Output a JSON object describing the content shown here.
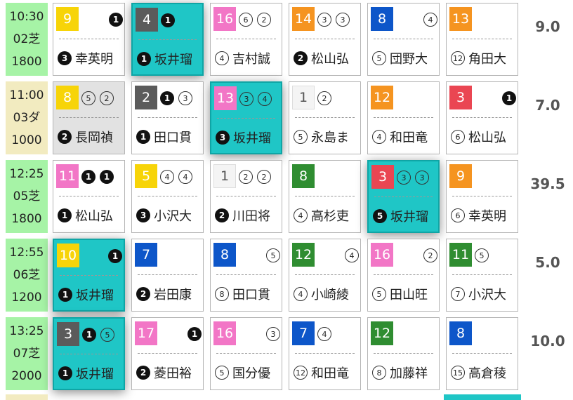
{
  "colors": {
    "yellow": "#f7d408",
    "dark_gray": "#5b5b5b",
    "pink": "#f276c6",
    "orange": "#f59420",
    "blue": "#0d56c9",
    "red": "#ea4652",
    "green": "#2f8d31",
    "white_gate": "#f4f4f4",
    "time_green": "#a6f3a6",
    "time_cream": "#f2ebc0",
    "highlight": "#1fc6c6"
  },
  "races": [
    {
      "time": "10:30",
      "course": "02芝",
      "distance": "1800",
      "time_bg": "#a6f3a6",
      "odds": "9.0",
      "horses": [
        {
          "gate_num": "9",
          "gate_color": "#f7d408",
          "marks": [
            {
              "t": "1",
              "s": "solid",
              "r": true
            }
          ],
          "jockey_mark": "3",
          "jockey": "幸英明",
          "bg": "white"
        },
        {
          "gate_num": "4",
          "gate_color": "#5b5b5b",
          "marks": [
            {
              "t": "1",
              "s": "solid"
            }
          ],
          "jockey_mark": "1",
          "jockey": "坂井瑠",
          "bg": "hl"
        },
        {
          "gate_num": "16",
          "gate_color": "#f276c6",
          "marks": [
            {
              "t": "6",
              "s": "outline"
            },
            {
              "t": "2",
              "s": "outline"
            }
          ],
          "jockey_mark": "4",
          "jockey": "吉村誠",
          "bg": "white"
        },
        {
          "gate_num": "14",
          "gate_color": "#f59420",
          "marks": [
            {
              "t": "3",
              "s": "outline"
            },
            {
              "t": "3",
              "s": "outline"
            }
          ],
          "jockey_mark": "2",
          "jockey": "松山弘",
          "bg": "white"
        },
        {
          "gate_num": "8",
          "gate_color": "#0d56c9",
          "marks": [
            {
              "t": "4",
              "s": "outline",
              "r": true
            }
          ],
          "jockey_mark": "5",
          "jockey": "団野大",
          "bg": "white"
        },
        {
          "gate_num": "13",
          "gate_color": "#f59420",
          "marks": [],
          "jockey_mark": "12",
          "jockey": "角田大",
          "bg": "white"
        }
      ]
    },
    {
      "time": "11:00",
      "course": "03ダ",
      "distance": "1000",
      "time_bg": "#f2ebc0",
      "odds": "7.0",
      "horses": [
        {
          "gate_num": "8",
          "gate_color": "#f7d408",
          "marks": [
            {
              "t": "5",
              "s": "outline"
            },
            {
              "t": "2",
              "s": "outline"
            }
          ],
          "jockey_mark": "2",
          "jockey": "長岡禎",
          "bg": "gray"
        },
        {
          "gate_num": "2",
          "gate_color": "#5b5b5b",
          "marks": [
            {
              "t": "1",
              "s": "solid"
            },
            {
              "t": "3",
              "s": "outline"
            }
          ],
          "jockey_mark": "1",
          "jockey": "田口貫",
          "bg": "white"
        },
        {
          "gate_num": "13",
          "gate_color": "#f276c6",
          "marks": [
            {
              "t": "3",
              "s": "outline"
            },
            {
              "t": "4",
              "s": "outline"
            }
          ],
          "jockey_mark": "3",
          "jockey": "坂井瑠",
          "bg": "hl"
        },
        {
          "gate_num": "1",
          "gate_color": "#f4f4f4",
          "marks": [
            {
              "t": "2",
              "s": "outline"
            }
          ],
          "jockey_mark": "5",
          "jockey": "永島ま",
          "bg": "white"
        },
        {
          "gate_num": "12",
          "gate_color": "#f59420",
          "marks": [],
          "jockey_mark": "4",
          "jockey": "和田竜",
          "bg": "white"
        },
        {
          "gate_num": "3",
          "gate_color": "#ea4652",
          "marks": [
            {
              "t": "1",
              "s": "solid",
              "r": true
            }
          ],
          "jockey_mark": "6",
          "jockey": "松山弘",
          "bg": "white"
        }
      ]
    },
    {
      "time": "12:25",
      "course": "05芝",
      "distance": "1800",
      "time_bg": "#a6f3a6",
      "odds": "39.5",
      "horses": [
        {
          "gate_num": "11",
          "gate_color": "#f276c6",
          "marks": [
            {
              "t": "1",
              "s": "solid"
            },
            {
              "t": "1",
              "s": "solid"
            }
          ],
          "jockey_mark": "1",
          "jockey": "松山弘",
          "bg": "white"
        },
        {
          "gate_num": "5",
          "gate_color": "#f7d408",
          "marks": [
            {
              "t": "4",
              "s": "outline"
            },
            {
              "t": "4",
              "s": "outline"
            }
          ],
          "jockey_mark": "3",
          "jockey": "小沢大",
          "bg": "white"
        },
        {
          "gate_num": "1",
          "gate_color": "#f4f4f4",
          "marks": [
            {
              "t": "2",
              "s": "outline"
            },
            {
              "t": "2",
              "s": "outline"
            }
          ],
          "jockey_mark": "2",
          "jockey": "川田将",
          "bg": "white"
        },
        {
          "gate_num": "8",
          "gate_color": "#2f8d31",
          "marks": [],
          "jockey_mark": "4",
          "jockey": "高杉吏",
          "bg": "white"
        },
        {
          "gate_num": "3",
          "gate_color": "#ea4652",
          "marks": [
            {
              "t": "3",
              "s": "outline"
            },
            {
              "t": "3",
              "s": "outline"
            }
          ],
          "jockey_mark": "5",
          "jockey": "坂井瑠",
          "bg": "hl"
        },
        {
          "gate_num": "9",
          "gate_color": "#f59420",
          "marks": [],
          "jockey_mark": "6",
          "jockey": "幸英明",
          "bg": "white"
        }
      ]
    },
    {
      "time": "12:55",
      "course": "06芝",
      "distance": "1200",
      "time_bg": "#a6f3a6",
      "odds": "5.0",
      "horses": [
        {
          "gate_num": "10",
          "gate_color": "#f7d408",
          "marks": [
            {
              "t": "1",
              "s": "solid",
              "r": true
            }
          ],
          "jockey_mark": "1",
          "jockey": "坂井瑠",
          "bg": "hl"
        },
        {
          "gate_num": "7",
          "gate_color": "#0d56c9",
          "marks": [],
          "jockey_mark": "2",
          "jockey": "岩田康",
          "bg": "white"
        },
        {
          "gate_num": "8",
          "gate_color": "#0d56c9",
          "marks": [
            {
              "t": "5",
              "s": "outline",
              "r": true
            }
          ],
          "jockey_mark": "8",
          "jockey": "田口貫",
          "bg": "white"
        },
        {
          "gate_num": "12",
          "gate_color": "#2f8d31",
          "marks": [
            {
              "t": "4",
              "s": "outline",
              "r": true
            }
          ],
          "jockey_mark": "4",
          "jockey": "小崎綾",
          "bg": "white"
        },
        {
          "gate_num": "16",
          "gate_color": "#f276c6",
          "marks": [
            {
              "t": "2",
              "s": "outline",
              "r": true
            }
          ],
          "jockey_mark": "5",
          "jockey": "田山旺",
          "bg": "white"
        },
        {
          "gate_num": "11",
          "gate_color": "#2f8d31",
          "marks": [
            {
              "t": "5",
              "s": "outline"
            }
          ],
          "jockey_mark": "7",
          "jockey": "小沢大",
          "bg": "white"
        }
      ]
    },
    {
      "time": "13:25",
      "course": "07芝",
      "distance": "2000",
      "time_bg": "#a6f3a6",
      "odds": "10.0",
      "horses": [
        {
          "gate_num": "3",
          "gate_color": "#5b5b5b",
          "marks": [
            {
              "t": "1",
              "s": "solid"
            },
            {
              "t": "5",
              "s": "outline"
            }
          ],
          "jockey_mark": "1",
          "jockey": "坂井瑠",
          "bg": "hl"
        },
        {
          "gate_num": "17",
          "gate_color": "#f276c6",
          "marks": [
            {
              "t": "1",
              "s": "solid",
              "r": true
            }
          ],
          "jockey_mark": "2",
          "jockey": "菱田裕",
          "bg": "white"
        },
        {
          "gate_num": "16",
          "gate_color": "#f276c6",
          "marks": [
            {
              "t": "3",
              "s": "outline",
              "r": true
            }
          ],
          "jockey_mark": "5",
          "jockey": "国分優",
          "bg": "white"
        },
        {
          "gate_num": "7",
          "gate_color": "#0d56c9",
          "marks": [
            {
              "t": "4",
              "s": "outline"
            }
          ],
          "jockey_mark": "12",
          "jockey": "和田竜",
          "bg": "white"
        },
        {
          "gate_num": "12",
          "gate_color": "#2f8d31",
          "marks": [],
          "jockey_mark": "8",
          "jockey": "加藤祥",
          "bg": "white"
        },
        {
          "gate_num": "8",
          "gate_color": "#0d56c9",
          "marks": [],
          "jockey_mark": "15",
          "jockey": "高倉稜",
          "bg": "white"
        }
      ]
    }
  ]
}
